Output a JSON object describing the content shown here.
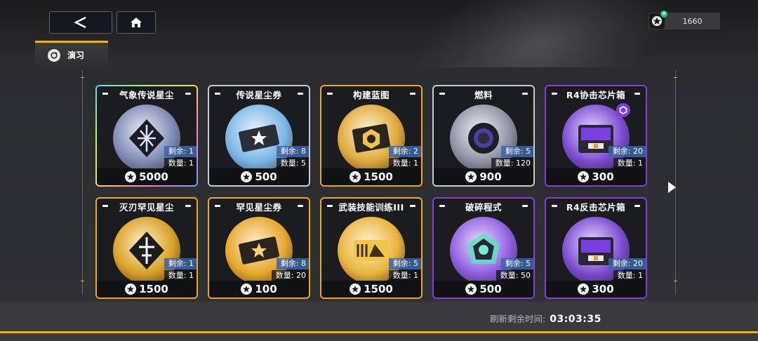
{
  "header": {
    "tab_label": "演习",
    "currency_value": "1660"
  },
  "shop": {
    "items": [
      {
        "title": "气象传说星尘",
        "stock": "剩余: 1",
        "qty": "数量: 1",
        "price": "5000",
        "frame": "rainbow",
        "icon": "stardust-legendary-icon"
      },
      {
        "title": "传说星尘券",
        "stock": "剩余: 8",
        "qty": "数量: 5",
        "price": "500",
        "frame": "silver",
        "icon": "ticket-legendary-icon"
      },
      {
        "title": "构建蓝图",
        "stock": "剩余: 2",
        "qty": "数量: 1",
        "price": "1500",
        "frame": "gold",
        "icon": "blueprint-icon"
      },
      {
        "title": "燃料",
        "stock": "剩余: 5",
        "qty": "数量: 120",
        "price": "900",
        "frame": "silver",
        "icon": "fuel-icon"
      },
      {
        "title": "R4协击芯片箱",
        "stock": "剩余: 20",
        "qty": "数量: 1",
        "price": "300",
        "frame": "purple",
        "icon": "chip-box-icon"
      },
      {
        "title": "灭刃罕见星尘",
        "stock": "剩余: 1",
        "qty": "数量: 1",
        "price": "1500",
        "frame": "gold",
        "icon": "stardust-rare-icon"
      },
      {
        "title": "罕见星尘券",
        "stock": "剩余: 8",
        "qty": "数量: 20",
        "price": "100",
        "frame": "gold",
        "icon": "ticket-rare-icon"
      },
      {
        "title": "武装技能训练III",
        "stock": "剩余: 5",
        "qty": "数量: 1",
        "price": "1500",
        "frame": "gold",
        "icon": "skill-training-icon"
      },
      {
        "title": "破碎程式",
        "stock": "剩余: 5",
        "qty": "数量: 50",
        "price": "500",
        "frame": "purple",
        "icon": "broken-program-icon"
      },
      {
        "title": "R4反击芯片箱",
        "stock": "剩余: 20",
        "qty": "数量: 1",
        "price": "300",
        "frame": "purple",
        "icon": "chip-box-icon"
      }
    ]
  },
  "footer": {
    "refresh_label": "刷新剩余时间:",
    "refresh_time": "03:03:35"
  },
  "colors": {
    "accent": "#f5b400",
    "gold_frame": "#f0a91b",
    "purple_frame": "#8a3cd6",
    "silver_frame": "#c8ccd3",
    "stock_bg": "#3c64aa"
  }
}
